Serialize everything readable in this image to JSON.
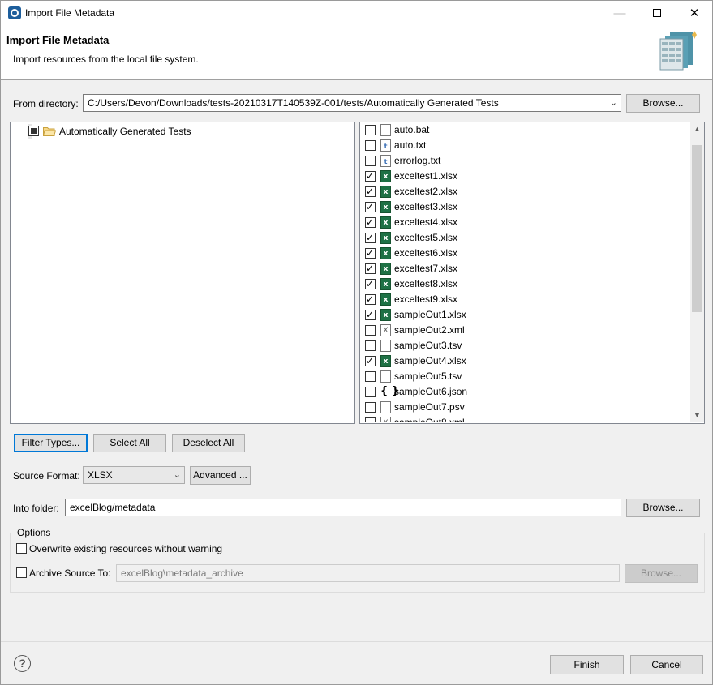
{
  "window": {
    "title": "Import File Metadata"
  },
  "header": {
    "title": "Import File Metadata",
    "description": "Import resources from the local file system."
  },
  "from_directory": {
    "label": "From directory:",
    "value": "C:/Users/Devon/Downloads/tests-20210317T140539Z-001/tests/Automatically Generated Tests",
    "browse_label": "Browse..."
  },
  "tree": {
    "items": [
      {
        "label": "Automatically Generated Tests",
        "state": "partial",
        "icon": "folder-open-icon"
      }
    ]
  },
  "files": [
    {
      "name": "auto.bat",
      "checked": false,
      "icon": "generic"
    },
    {
      "name": "auto.txt",
      "checked": false,
      "icon": "txt"
    },
    {
      "name": "errorlog.txt",
      "checked": false,
      "icon": "txt"
    },
    {
      "name": "exceltest1.xlsx",
      "checked": true,
      "icon": "excel"
    },
    {
      "name": "exceltest2.xlsx",
      "checked": true,
      "icon": "excel"
    },
    {
      "name": "exceltest3.xlsx",
      "checked": true,
      "icon": "excel"
    },
    {
      "name": "exceltest4.xlsx",
      "checked": true,
      "icon": "excel"
    },
    {
      "name": "exceltest5.xlsx",
      "checked": true,
      "icon": "excel"
    },
    {
      "name": "exceltest6.xlsx",
      "checked": true,
      "icon": "excel"
    },
    {
      "name": "exceltest7.xlsx",
      "checked": true,
      "icon": "excel"
    },
    {
      "name": "exceltest8.xlsx",
      "checked": true,
      "icon": "excel"
    },
    {
      "name": "exceltest9.xlsx",
      "checked": true,
      "icon": "excel"
    },
    {
      "name": "sampleOut1.xlsx",
      "checked": true,
      "icon": "excel"
    },
    {
      "name": "sampleOut2.xml",
      "checked": false,
      "icon": "xml"
    },
    {
      "name": "sampleOut3.tsv",
      "checked": false,
      "icon": "generic"
    },
    {
      "name": "sampleOut4.xlsx",
      "checked": true,
      "icon": "excel"
    },
    {
      "name": "sampleOut5.tsv",
      "checked": false,
      "icon": "generic"
    },
    {
      "name": "sampleOut6.json",
      "checked": false,
      "icon": "json"
    },
    {
      "name": "sampleOut7.psv",
      "checked": false,
      "icon": "generic"
    },
    {
      "name": "sampleOut8.xml",
      "checked": false,
      "icon": "xml"
    }
  ],
  "selection_buttons": {
    "filter_types": "Filter Types...",
    "select_all": "Select All",
    "deselect_all": "Deselect All"
  },
  "source_format": {
    "label": "Source Format:",
    "value": "XLSX",
    "advanced_label": "Advanced ..."
  },
  "into_folder": {
    "label": "Into folder:",
    "value": "excelBlog/metadata",
    "browse_label": "Browse..."
  },
  "options": {
    "title": "Options",
    "overwrite_label": "Overwrite existing resources without warning",
    "overwrite_checked": false,
    "archive_label": "Archive Source To:",
    "archive_checked": false,
    "archive_value": "excelBlog\\metadata_archive",
    "archive_browse_label": "Browse..."
  },
  "footer": {
    "finish_label": "Finish",
    "cancel_label": "Cancel",
    "help_symbol": "?"
  },
  "colors": {
    "focus": "#0078d7",
    "excel": "#1e7145"
  }
}
